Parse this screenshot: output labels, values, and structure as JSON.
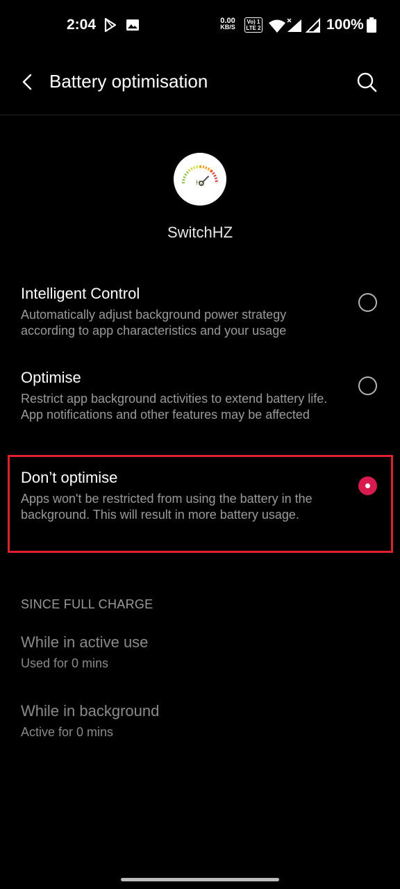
{
  "status_bar": {
    "time": "2:04",
    "net_speed_value": "0.00",
    "net_speed_unit": "KB/S",
    "volte_top": "Vo) 1",
    "volte_bottom": "LTE 2",
    "battery_percent": "100%",
    "icons": [
      "play-store-icon",
      "image-icon",
      "wifi-icon",
      "signal-icon",
      "signal-icon",
      "battery-icon"
    ]
  },
  "app_bar": {
    "title": "Battery optimisation",
    "back_icon": "back-arrow-icon",
    "search_icon": "search-icon"
  },
  "app": {
    "name": "SwitchHZ"
  },
  "options": [
    {
      "title": "Intelligent Control",
      "description": "Automatically adjust background power strategy according to app characteristics and your usage",
      "selected": false
    },
    {
      "title": "Optimise",
      "description": "Restrict app background activities to extend battery life. App notifications and other features may be affected",
      "selected": false
    },
    {
      "title": "Don’t optimise",
      "description": "Apps won't be restricted from using the battery in the background. This will result in more battery usage.",
      "selected": true
    }
  ],
  "usage": {
    "header": "SINCE FULL CHARGE",
    "items": [
      {
        "title": "While in active use",
        "value": "Used for 0 mins"
      },
      {
        "title": "While in background",
        "value": "Active for 0 mins"
      }
    ]
  },
  "colors": {
    "background": "#000000",
    "accent": "#d81b4f",
    "highlight": "#e0202e"
  }
}
